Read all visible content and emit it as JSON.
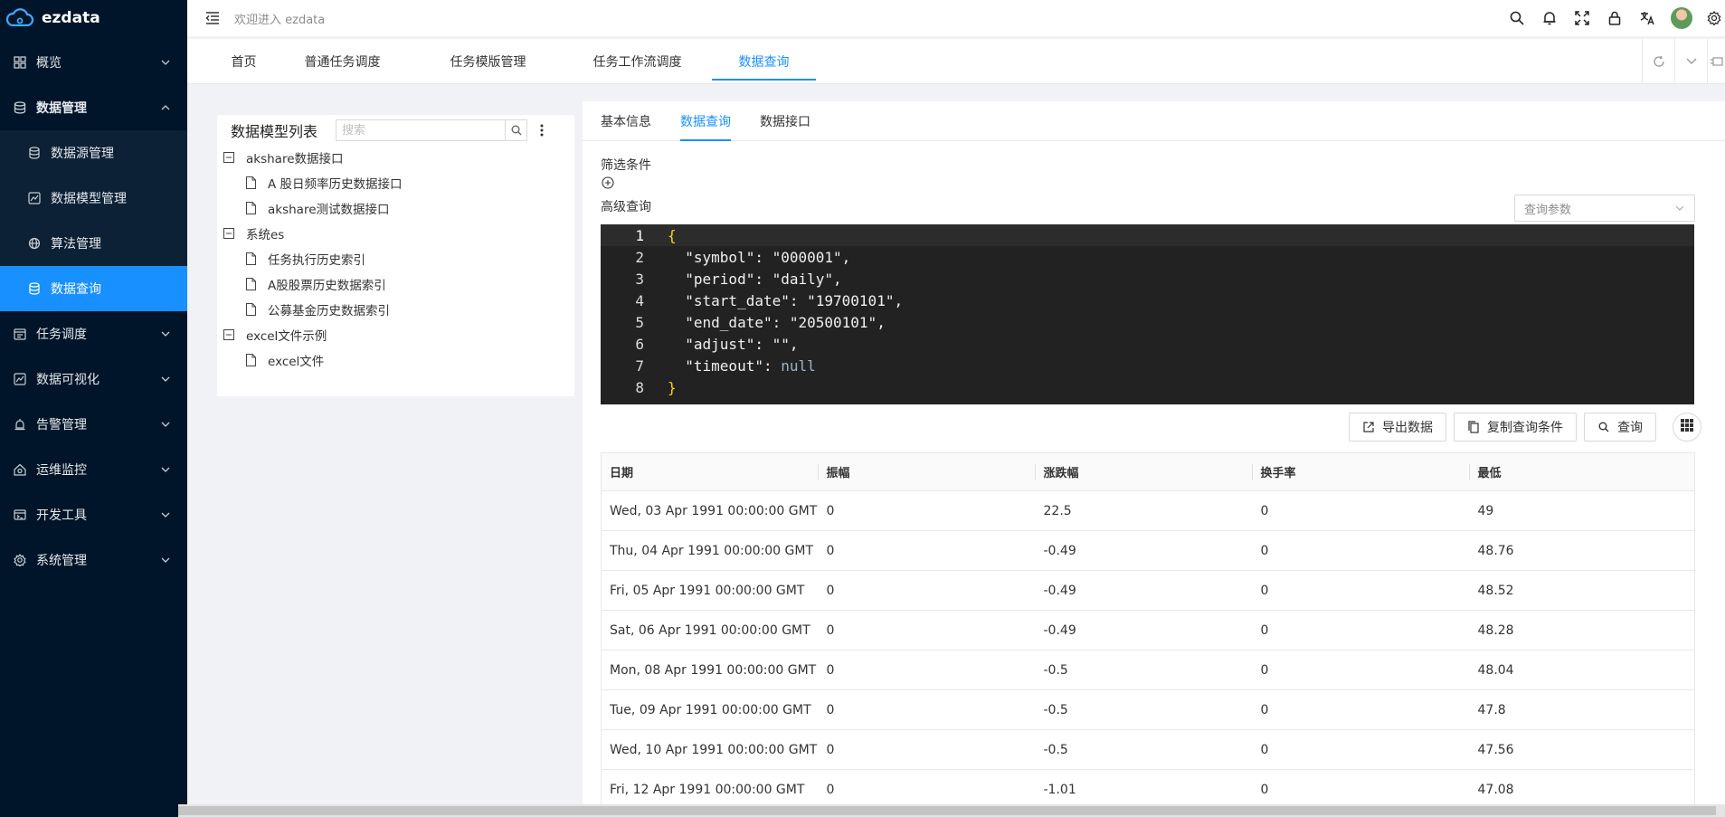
{
  "app": {
    "name": "ezdata"
  },
  "header": {
    "welcome": "欢迎进入 ezdata"
  },
  "sidebar": {
    "items": [
      {
        "label": "概览",
        "icon": "dashboard-icon",
        "expanded": false
      },
      {
        "label": "数据管理",
        "icon": "database-icon",
        "expanded": true,
        "children": [
          {
            "label": "数据源管理",
            "icon": "datasource-icon"
          },
          {
            "label": "数据模型管理",
            "icon": "model-icon"
          },
          {
            "label": "算法管理",
            "icon": "algorithm-icon"
          },
          {
            "label": "数据查询",
            "icon": "query-icon",
            "active": true
          }
        ]
      },
      {
        "label": "任务调度",
        "icon": "schedule-icon",
        "expanded": false
      },
      {
        "label": "数据可视化",
        "icon": "chart-icon",
        "expanded": false
      },
      {
        "label": "告警管理",
        "icon": "alarm-icon",
        "expanded": false
      },
      {
        "label": "运维监控",
        "icon": "monitor-icon",
        "expanded": false
      },
      {
        "label": "开发工具",
        "icon": "devtools-icon",
        "expanded": false
      },
      {
        "label": "系统管理",
        "icon": "settings-icon",
        "expanded": false
      }
    ]
  },
  "nav_tabs": [
    {
      "label": "首页"
    },
    {
      "label": "普通任务调度"
    },
    {
      "label": "任务模版管理"
    },
    {
      "label": "任务工作流调度"
    },
    {
      "label": "数据查询",
      "active": true
    }
  ],
  "model_panel": {
    "title": "数据模型列表",
    "search_placeholder": "搜索",
    "tree": [
      {
        "label": "akshare数据接口",
        "children": [
          {
            "label": "A 股日频率历史数据接口"
          },
          {
            "label": "akshare测试数据接口"
          }
        ]
      },
      {
        "label": "系统es",
        "children": [
          {
            "label": "任务执行历史索引"
          },
          {
            "label": "A股股票历史数据索引"
          },
          {
            "label": "公募基金历史数据索引"
          }
        ]
      },
      {
        "label": "excel文件示例",
        "children": [
          {
            "label": "excel文件"
          }
        ]
      }
    ]
  },
  "main": {
    "sub_tabs": [
      {
        "label": "基本信息"
      },
      {
        "label": "数据查询",
        "active": true
      },
      {
        "label": "数据接口"
      }
    ],
    "filter_label": "筛选条件",
    "advanced_label": "高级查询",
    "param_select_placeholder": "查询参数",
    "code_lines": [
      "{",
      "  \"symbol\": \"000001\",",
      "  \"period\": \"daily\",",
      "  \"start_date\": \"19700101\",",
      "  \"end_date\": \"20500101\",",
      "  \"adjust\": \"\",",
      "  \"timeout\": null",
      "}"
    ],
    "actions": {
      "export": "导出数据",
      "copy": "复制查询条件",
      "query": "查询"
    },
    "table": {
      "columns": [
        "日期",
        "振幅",
        "涨跌幅",
        "换手率",
        "最低"
      ],
      "rows": [
        [
          "Wed, 03 Apr 1991 00:00:00 GMT",
          "0",
          "22.5",
          "0",
          "49"
        ],
        [
          "Thu, 04 Apr 1991 00:00:00 GMT",
          "0",
          "-0.49",
          "0",
          "48.76"
        ],
        [
          "Fri, 05 Apr 1991 00:00:00 GMT",
          "0",
          "-0.49",
          "0",
          "48.52"
        ],
        [
          "Sat, 06 Apr 1991 00:00:00 GMT",
          "0",
          "-0.49",
          "0",
          "48.28"
        ],
        [
          "Mon, 08 Apr 1991 00:00:00 GMT",
          "0",
          "-0.5",
          "0",
          "48.04"
        ],
        [
          "Tue, 09 Apr 1991 00:00:00 GMT",
          "0",
          "-0.5",
          "0",
          "47.8"
        ],
        [
          "Wed, 10 Apr 1991 00:00:00 GMT",
          "0",
          "-0.5",
          "0",
          "47.56"
        ],
        [
          "Fri, 12 Apr 1991 00:00:00 GMT",
          "0",
          "-1.01",
          "0",
          "47.08"
        ]
      ]
    }
  },
  "colors": {
    "sidebar_bg": "#001529",
    "accent": "#1890ff",
    "editor_bg": "#222222"
  }
}
